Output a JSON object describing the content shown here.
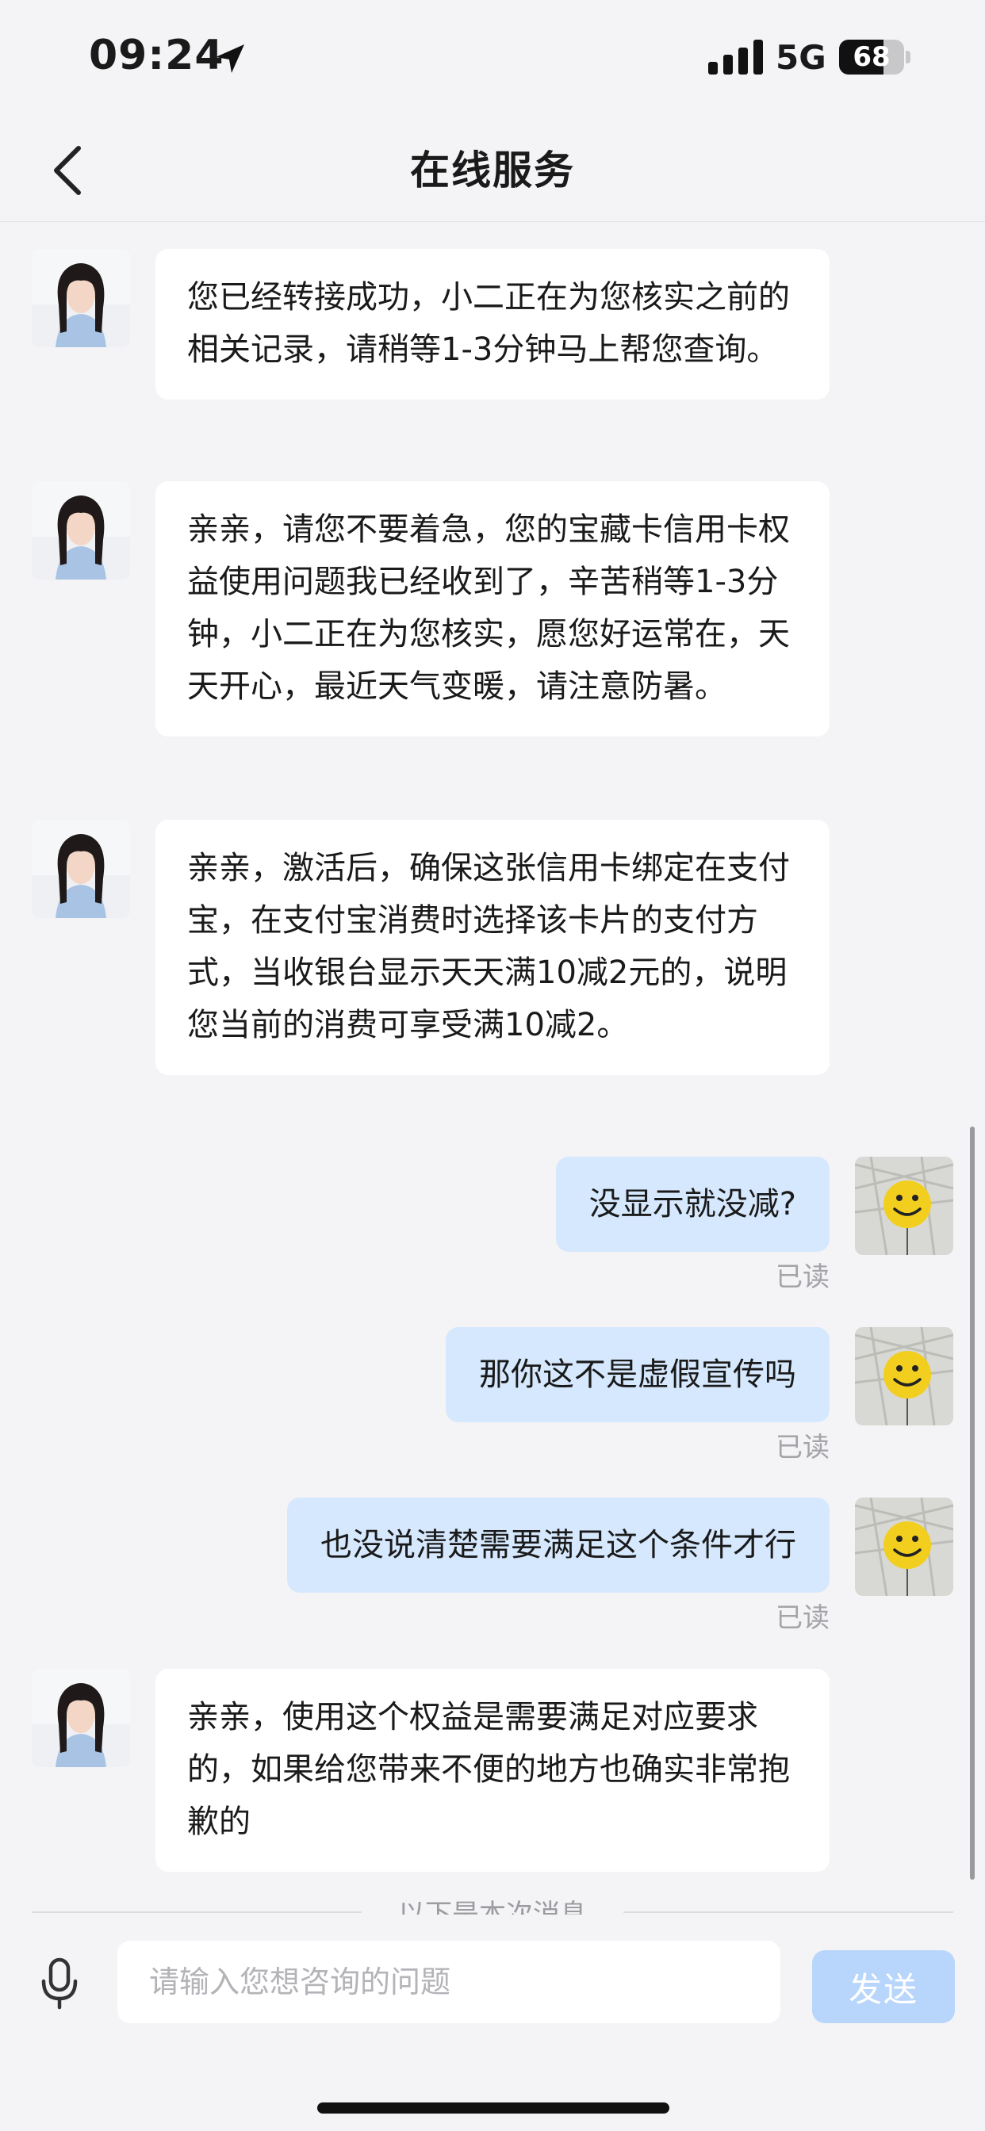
{
  "status_bar": {
    "time": "09:24",
    "network": "5G",
    "battery": "68",
    "battery_level": 0.68
  },
  "header": {
    "title": "在线服务"
  },
  "messages": [
    {
      "from": "agent",
      "text": "您已经转接成功，小二正在为您核实之前的相关记录，请稍等1-3分钟马上帮您查询。"
    },
    {
      "from": "agent",
      "text": "亲亲，请您不要着急，您的宝藏卡信用卡权益使用问题我已经收到了，辛苦稍等1-3分钟，小二正在为您核实，愿您好运常在，天天开心，最近天气变暖，请注意防暑。"
    },
    {
      "from": "agent",
      "text": "亲亲，激活后，确保这张信用卡绑定在支付宝，在支付宝消费时选择该卡片的支付方式，当收银台显示天天满10减2元的，说明您当前的消费可享受满10减2。"
    },
    {
      "from": "user",
      "text": "没显示就没减?",
      "status": "已读"
    },
    {
      "from": "user",
      "text": "那你这不是虚假宣传吗",
      "status": "已读"
    },
    {
      "from": "user",
      "text": "也没说清楚需要满足这个条件才行",
      "status": "已读"
    },
    {
      "from": "agent",
      "text": "亲亲，使用这个权益是需要满足对应要求的，如果给您带来不便的地方也确实非常抱歉的"
    }
  ],
  "divider_text": "以下是本次消息",
  "input": {
    "placeholder": "请输入您想咨询的问题",
    "value": ""
  },
  "send_label": "发送",
  "icons": {
    "back": "chevron-left-icon",
    "mic": "microphone-icon",
    "location": "location-arrow-icon",
    "signal": "signal-bars-icon"
  },
  "colors": {
    "user_bubble": "#d6e8fd",
    "agent_bubble": "#ffffff",
    "send_button": "#b8d6fb",
    "background": "#f4f4f6"
  }
}
